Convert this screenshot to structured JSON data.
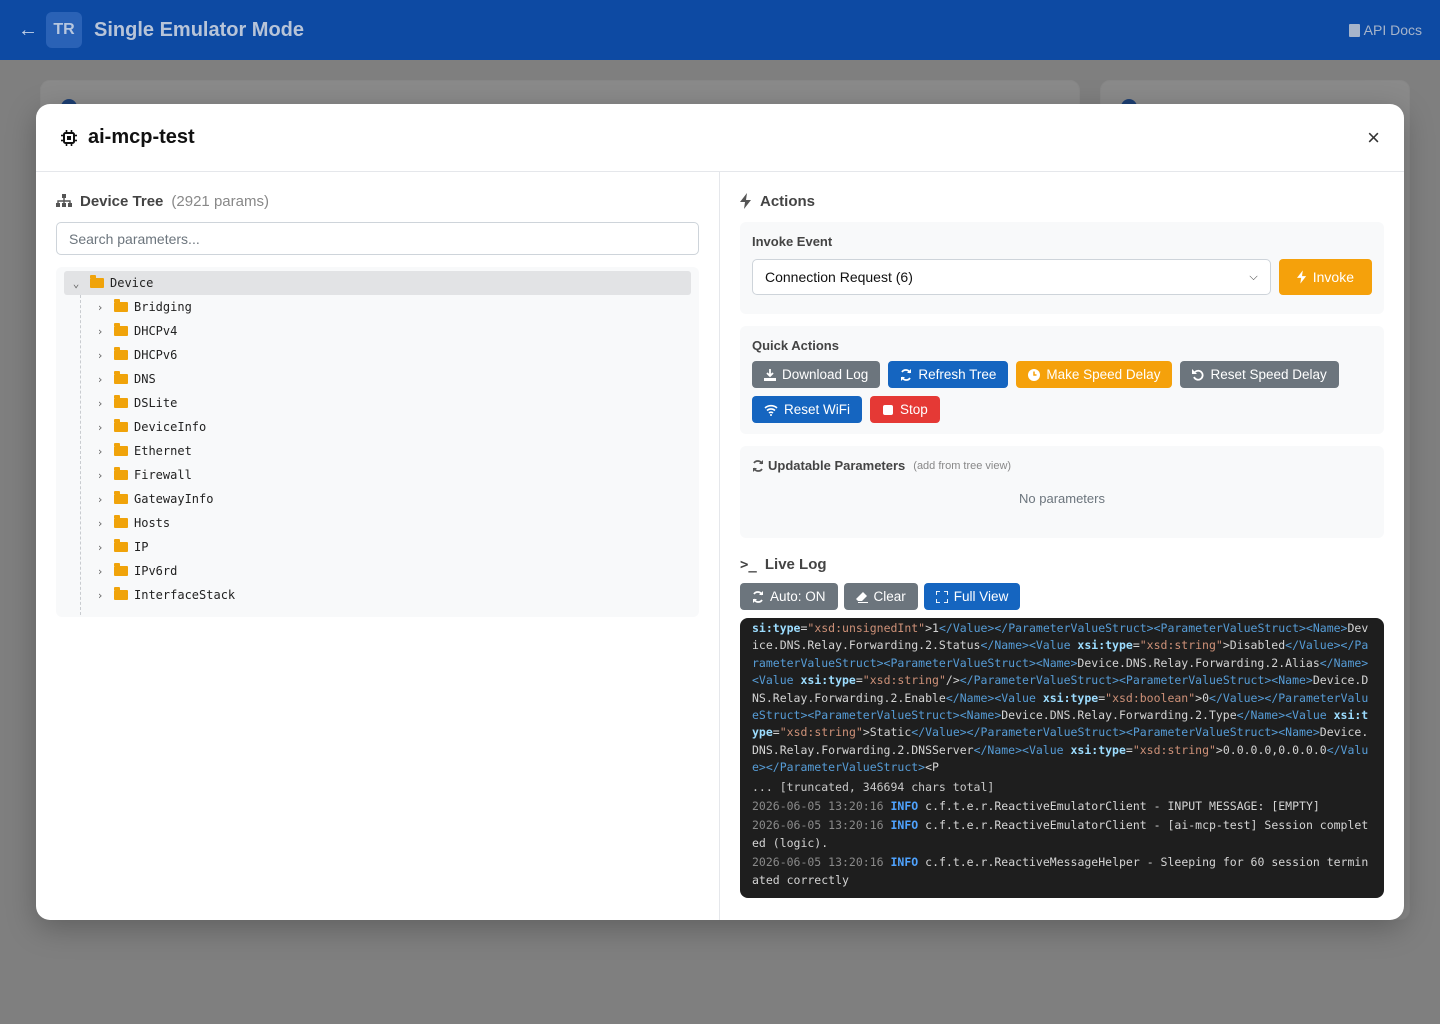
{
  "app": {
    "back_icon": "arrow-left-icon",
    "logo_text": "TR",
    "title": "Single Emulator Mode",
    "docs_label": "API Docs"
  },
  "modal": {
    "title": "ai-mcp-test",
    "close_label": "×"
  },
  "tree": {
    "title": "Device Tree",
    "count": "(2921 params)",
    "search_placeholder": "Search parameters...",
    "root": "Device",
    "children": [
      "Bridging",
      "DHCPv4",
      "DHCPv6",
      "DNS",
      "DSLite",
      "DeviceInfo",
      "Ethernet",
      "Firewall",
      "GatewayInfo",
      "Hosts",
      "IP",
      "IPv6rd",
      "InterfaceStack"
    ]
  },
  "actions": {
    "title": "Actions",
    "invoke_label": "Invoke Event",
    "selected_event": "Connection Request (6)",
    "invoke_button": "Invoke",
    "quick_label": "Quick Actions",
    "quick": {
      "download_log": "Download Log",
      "refresh_tree": "Refresh Tree",
      "make_speed_delay": "Make Speed Delay",
      "reset_speed_delay": "Reset Speed Delay",
      "reset_wifi": "Reset WiFi",
      "stop": "Stop"
    }
  },
  "updatable": {
    "title": "Updatable Parameters",
    "hint": "(add from tree view)",
    "empty": "No parameters"
  },
  "live_log": {
    "title": "Live Log",
    "auto": "Auto: ON",
    "clear": "Clear",
    "full_view": "Full View",
    "truncated": "... [truncated, 346694 chars total]",
    "entries": [
      {
        "ts": "2026-06-05 13:20:16",
        "level": "INFO",
        "msg": "c.f.t.e.r.ReactiveEmulatorClient - INPUT MESSAGE: [EMPTY]"
      },
      {
        "ts": "2026-06-05 13:20:16",
        "level": "INFO",
        "msg": "c.f.t.e.r.ReactiveEmulatorClient - [ai-mcp-test] Session completed (logic)."
      },
      {
        "ts": "2026-06-05 13:20:16",
        "level": "INFO",
        "msg": "c.f.t.e.r.ReactiveMessageHelper - Sleeping for 60 session terminated correctly"
      }
    ]
  },
  "colors": {
    "primary": "#1565c0",
    "warning": "#f5a10b",
    "danger": "#e53935",
    "secondary": "#6c757d"
  }
}
